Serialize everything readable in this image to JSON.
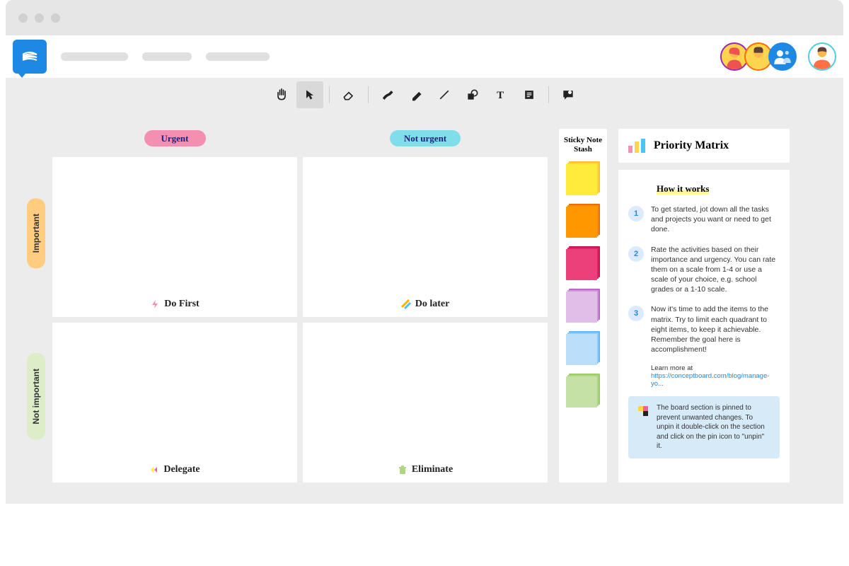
{
  "matrix": {
    "col_labels": {
      "urgent": "Urgent",
      "not_urgent": "Not urgent"
    },
    "row_labels": {
      "important": "Important",
      "not_important": "Not important"
    },
    "quadrants": {
      "do_first": "Do First",
      "do_later": "Do later",
      "delegate": "Delegate",
      "eliminate": "Eliminate"
    }
  },
  "stash": {
    "title": "Sticky Note Stash",
    "colors": [
      "#ffeb3b",
      "#ff9800",
      "#ec407a",
      "#ce93d8",
      "#90caf9",
      "#aeea00"
    ]
  },
  "info": {
    "title": "Priority Matrix",
    "how_title": "How it works",
    "steps": [
      {
        "n": "1",
        "text": "To get started, jot down all the tasks and projects you want or need to get done."
      },
      {
        "n": "2",
        "text": "Rate the activities based on their importance and urgency. You can rate them on a scale from 1-4 or use a scale of your choice, e.g. school grades or a 1-10 scale."
      },
      {
        "n": "3",
        "text": "Now it's time to add the items to the matrix. Try to limit each quadrant to eight items, to keep it achievable. Remember the goal here is accomplishment!"
      }
    ],
    "learn_label": "Learn more at",
    "learn_link": "https://conceptboard.com/blog/manage-yo...",
    "tip": "The board section is pinned to prevent unwanted changes. To unpin it double-click on the section and click on the pin icon to \"unpin\" it."
  }
}
